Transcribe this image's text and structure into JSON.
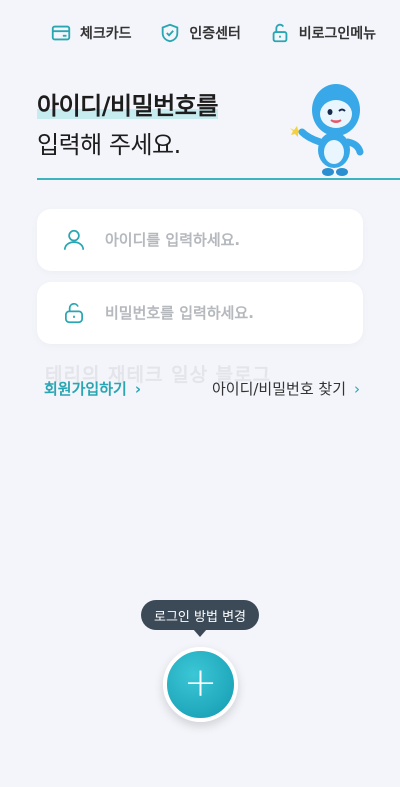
{
  "topnav": {
    "items": [
      {
        "label": "체크카드",
        "icon": "card-icon"
      },
      {
        "label": "인증센터",
        "icon": "shield-check-icon"
      },
      {
        "label": "비로그인메뉴",
        "icon": "unlock-icon"
      }
    ]
  },
  "headline": {
    "line1": "아이디/비밀번호를",
    "line2": "입력해 주세요."
  },
  "form": {
    "id_placeholder": "아이디를 입력하세요.",
    "pw_placeholder": "비밀번호를 입력하세요."
  },
  "watermark": "테리의 재테크 일상 블로그",
  "links": {
    "signup": "회원가입하기",
    "find": "아이디/비밀번호 찾기"
  },
  "tooltip": "로그인 방법 변경",
  "colors": {
    "accent": "#2aa6b3",
    "background": "#f3f5fa",
    "tooltip": "#3c4a58"
  }
}
